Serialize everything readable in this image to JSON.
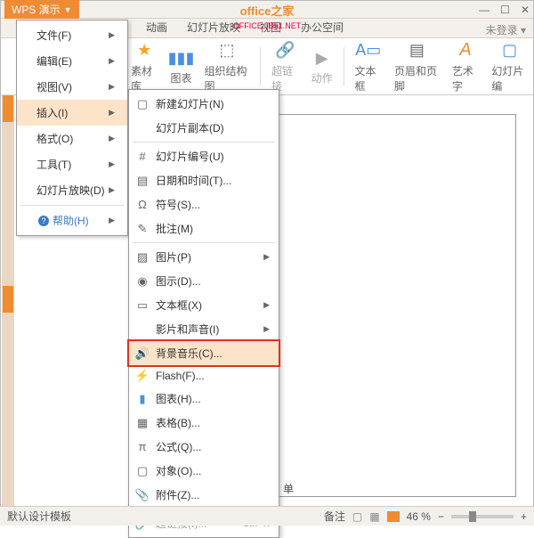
{
  "header": {
    "app_name": "WPS 演示",
    "logo_text": "office之家",
    "logo_url": "OFFICE.JB51.NET"
  },
  "window_controls": {
    "min": "—",
    "max": "☐",
    "close": "✕"
  },
  "tabs": {
    "t1": "动画",
    "t2": "幻灯片放映",
    "t3": "视图",
    "t4": "办公空间",
    "login": "未登录 ▾"
  },
  "ribbon": {
    "r1": "素材库",
    "r2": "图表",
    "r3": "组织结构图",
    "r4": "超链接",
    "r5": "动作",
    "r6": "文本框",
    "r7": "页眉和页脚",
    "r8": "艺术字",
    "r9": "幻灯片编"
  },
  "menu": {
    "file": "文件(F)",
    "edit": "编辑(E)",
    "view": "视图(V)",
    "insert": "插入(I)",
    "format": "格式(O)",
    "tools": "工具(T)",
    "slideshow": "幻灯片放映(D)",
    "help": "帮助(H)"
  },
  "submenu": {
    "new_slide": "新建幻灯片(N)",
    "dup_slide": "幻灯片副本(D)",
    "slide_num": "幻灯片编号(U)",
    "datetime": "日期和时间(T)...",
    "symbol": "符号(S)...",
    "comment": "批注(M)",
    "picture": "图片(P)",
    "diagram": "图示(D)...",
    "textbox": "文本框(X)",
    "movie_sound": "影片和声音(I)",
    "bg_music": "背景音乐(C)...",
    "flash": "Flash(F)...",
    "chart": "图表(H)...",
    "table": "表格(B)...",
    "equation": "公式(Q)...",
    "object": "对象(O)...",
    "attachment": "附件(Z)...",
    "hyperlink": "超链接(I)...",
    "hyperlink_kb": "Ctrl+K"
  },
  "status": {
    "template": "默认设计模板",
    "ime": "备注",
    "zoom": "46 %",
    "single": "单"
  },
  "colors": {
    "accent": "#f08b32",
    "highlight_bg": "#fde4c9"
  }
}
